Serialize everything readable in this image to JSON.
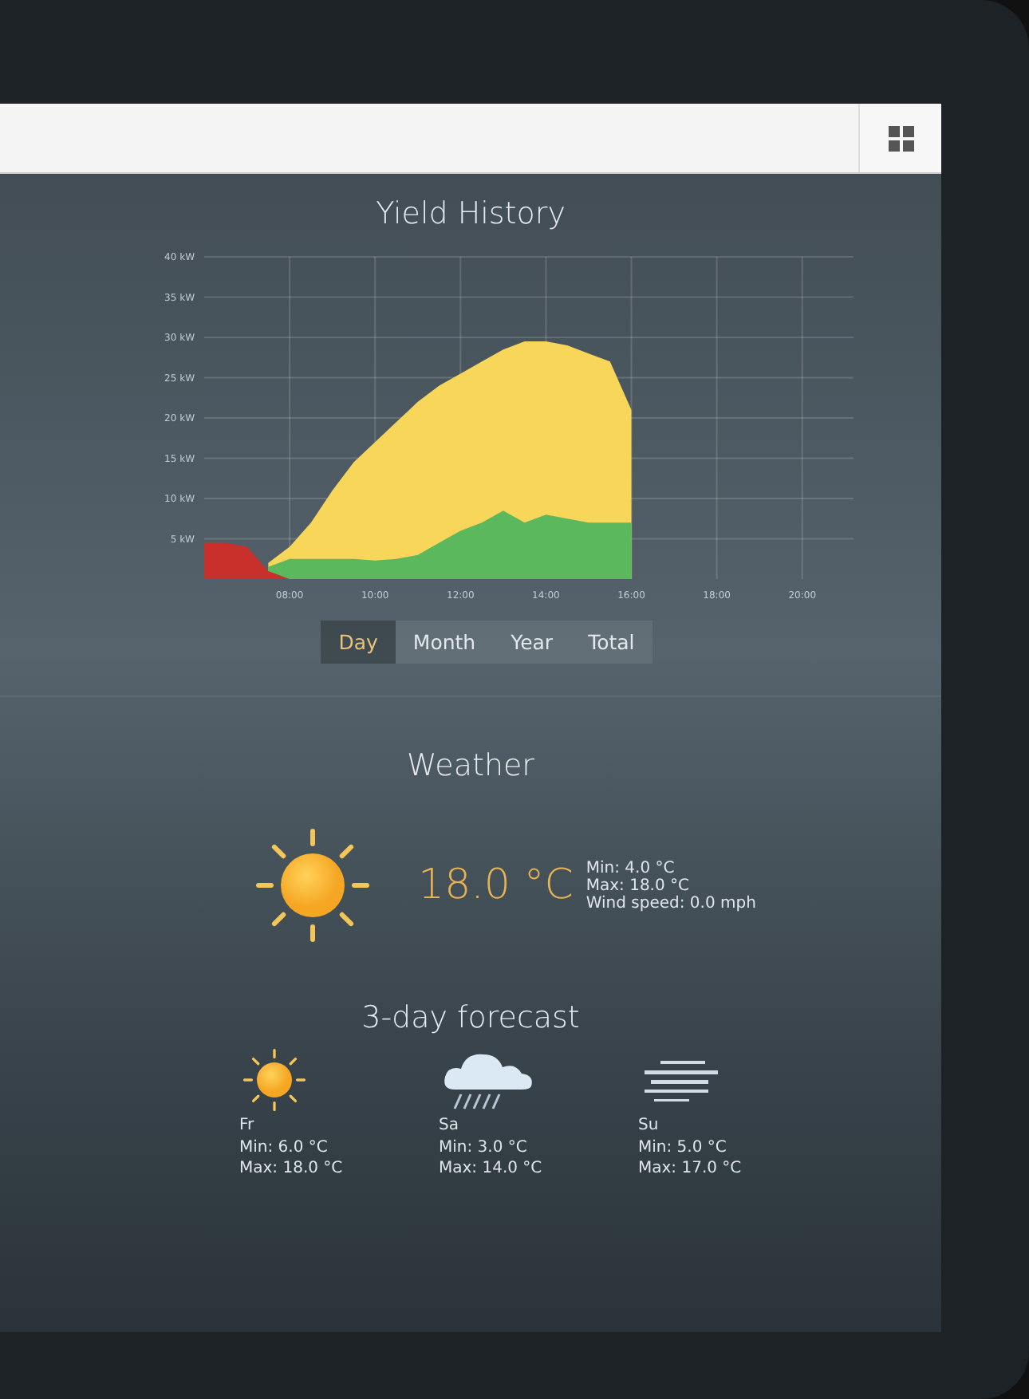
{
  "yield_history": {
    "title": "Yield History",
    "chart_data": {
      "type": "area",
      "x": [
        6,
        6.5,
        7,
        7.5,
        8,
        8.5,
        9,
        9.5,
        10,
        10.5,
        11,
        11.5,
        12,
        12.5,
        13,
        13.5,
        14,
        14.5,
        15,
        15.5,
        16
      ],
      "series": [
        {
          "color": "#f7d65a",
          "values": [
            null,
            null,
            null,
            2,
            4,
            7,
            11,
            14.5,
            17,
            19.5,
            22,
            24,
            25.5,
            27,
            28.5,
            29.5,
            29.5,
            29,
            28,
            27,
            21
          ]
        },
        {
          "color": "#5cb85c",
          "values": [
            null,
            null,
            null,
            1.5,
            2.5,
            2.5,
            2.5,
            2.5,
            2.3,
            2.5,
            3,
            4.5,
            6,
            7,
            8.5,
            7,
            8,
            7.5,
            7,
            7,
            7
          ]
        },
        {
          "color": "#c9302c",
          "values": [
            4.5,
            4.5,
            4,
            1,
            0,
            null,
            null,
            null,
            null,
            null,
            null,
            null,
            null,
            null,
            null,
            null,
            null,
            null,
            null,
            null,
            null
          ]
        }
      ],
      "grid": true,
      "xlim": [
        6,
        21.2
      ],
      "ylim": [
        0,
        40
      ],
      "xticks": [
        {
          "value": 8,
          "label": "08:00"
        },
        {
          "value": 10,
          "label": "10:00"
        },
        {
          "value": 12,
          "label": "12:00"
        },
        {
          "value": 14,
          "label": "14:00"
        },
        {
          "value": 16,
          "label": "16:00"
        },
        {
          "value": 18,
          "label": "18:00"
        },
        {
          "value": 20,
          "label": "20:00"
        }
      ],
      "yticks": [
        {
          "value": 5,
          "label": "5 kW"
        },
        {
          "value": 10,
          "label": "10 kW"
        },
        {
          "value": 15,
          "label": "15 kW"
        },
        {
          "value": 20,
          "label": "20 kW"
        },
        {
          "value": 25,
          "label": "25 kW"
        },
        {
          "value": 30,
          "label": "30 kW"
        },
        {
          "value": 35,
          "label": "35 kW"
        },
        {
          "value": 40,
          "label": "40 kW"
        }
      ]
    },
    "tabs": [
      {
        "label": "Day",
        "selected": true
      },
      {
        "label": "Month",
        "selected": false
      },
      {
        "label": "Year",
        "selected": false
      },
      {
        "label": "Total",
        "selected": false
      }
    ]
  },
  "weather": {
    "title": "Weather",
    "kind": "sun",
    "temperature": "18.0 °C",
    "details": [
      "Min: 4.0 °C",
      "Max: 18.0 °C",
      "Wind speed: 0.0 mph"
    ]
  },
  "forecast": {
    "title": "3-day forecast",
    "days": [
      {
        "kind": "sun",
        "day": "Fr",
        "min": "Min: 6.0 °C",
        "max": "Max: 18.0 °C"
      },
      {
        "kind": "rain",
        "day": "Sa",
        "min": "Min: 3.0 °C",
        "max": "Max: 14.0 °C"
      },
      {
        "kind": "wind",
        "day": "Su",
        "min": "Min: 5.0 °C",
        "max": "Max: 17.0 °C"
      }
    ]
  }
}
